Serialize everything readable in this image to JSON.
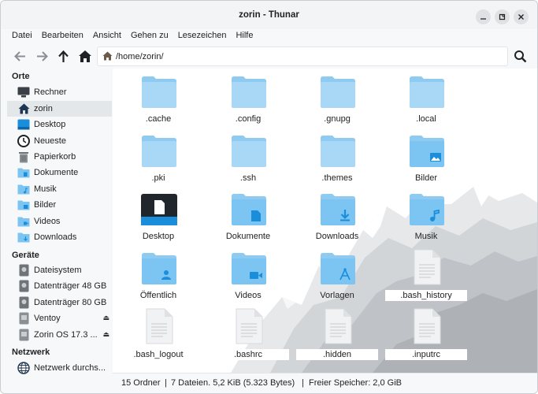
{
  "window": {
    "title": "zorin - Thunar"
  },
  "menu": [
    "Datei",
    "Bearbeiten",
    "Ansicht",
    "Gehen zu",
    "Lesezeichen",
    "Hilfe"
  ],
  "toolbar": {
    "path": "/home/zorin/"
  },
  "sidebar": {
    "sections": {
      "orte": "Orte",
      "geraete": "Geräte",
      "netzwerk": "Netzwerk"
    },
    "places": [
      {
        "label": "Rechner",
        "icon": "computer-icon"
      },
      {
        "label": "zorin",
        "icon": "home-icon",
        "selected": true
      },
      {
        "label": "Desktop",
        "icon": "desktop-icon"
      },
      {
        "label": "Neueste",
        "icon": "clock-icon"
      },
      {
        "label": "Papierkorb",
        "icon": "trash-icon"
      },
      {
        "label": "Dokumente",
        "icon": "folder-icon"
      },
      {
        "label": "Musik",
        "icon": "folder-icon"
      },
      {
        "label": "Bilder",
        "icon": "folder-icon"
      },
      {
        "label": "Videos",
        "icon": "folder-icon"
      },
      {
        "label": "Downloads",
        "icon": "folder-icon"
      }
    ],
    "devices": [
      {
        "label": "Dateisystem",
        "icon": "drive-icon"
      },
      {
        "label": "Datenträger 48 GB",
        "icon": "drive-icon"
      },
      {
        "label": "Datenträger 80 GB",
        "icon": "drive-icon"
      },
      {
        "label": "Ventoy",
        "icon": "drive-icon",
        "eject": true
      },
      {
        "label": "Zorin OS 17.3 ...",
        "icon": "drive-icon",
        "eject": true
      }
    ],
    "network": [
      {
        "label": "Netzwerk durchs...",
        "icon": "globe-icon"
      }
    ]
  },
  "files": [
    {
      "name": ".cache",
      "type": "folder",
      "emblem": ""
    },
    {
      "name": ".config",
      "type": "folder",
      "emblem": ""
    },
    {
      "name": ".gnupg",
      "type": "folder",
      "emblem": ""
    },
    {
      "name": ".local",
      "type": "folder",
      "emblem": ""
    },
    {
      "name": ".pki",
      "type": "folder",
      "emblem": ""
    },
    {
      "name": ".ssh",
      "type": "folder",
      "emblem": ""
    },
    {
      "name": ".themes",
      "type": "folder",
      "emblem": ""
    },
    {
      "name": "Bilder",
      "type": "folder",
      "emblem": "picture"
    },
    {
      "name": "Desktop",
      "type": "desktop",
      "emblem": ""
    },
    {
      "name": "Dokumente",
      "type": "folder",
      "emblem": "document"
    },
    {
      "name": "Downloads",
      "type": "folder",
      "emblem": "download"
    },
    {
      "name": "Musik",
      "type": "folder",
      "emblem": "music"
    },
    {
      "name": "Öffentlich",
      "type": "folder",
      "emblem": "person"
    },
    {
      "name": "Videos",
      "type": "folder",
      "emblem": "video"
    },
    {
      "name": "Vorlagen",
      "type": "folder",
      "emblem": "template"
    },
    {
      "name": ".bash_history",
      "type": "file",
      "emblem": ""
    },
    {
      "name": ".bash_logout",
      "type": "file",
      "emblem": ""
    },
    {
      "name": ".bashrc",
      "type": "file",
      "emblem": ""
    },
    {
      "name": ".hidden",
      "type": "file",
      "emblem": ""
    },
    {
      "name": ".inputrc",
      "type": "file",
      "emblem": ""
    }
  ],
  "status": {
    "folders": "15 Ordner",
    "files": "7 Dateien. 5,2 KiB (5.323 Bytes)",
    "free": "Freier Speicher: 2,0 GiB",
    "separator": "|"
  },
  "colors": {
    "folder": "#a9d8f6",
    "folder_tab": "#8fcaf0",
    "folder_special": "#7cc4f1",
    "emblem": "#1a8ddb",
    "accent": "#0b67a9"
  }
}
